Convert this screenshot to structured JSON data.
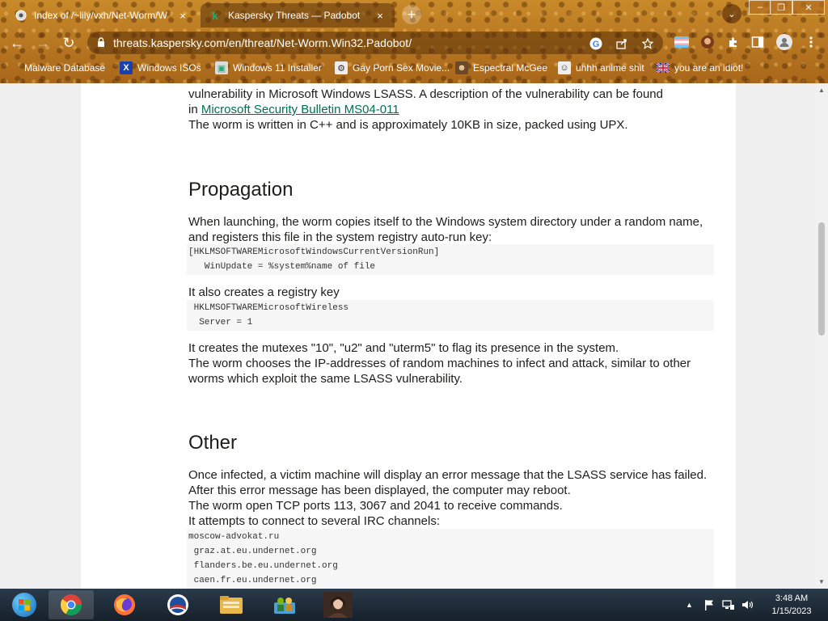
{
  "browser": {
    "tabs": [
      {
        "title": "Index of /~lily/vxh/Net-Worm/W",
        "favicon": "website-icon",
        "close": "×"
      },
      {
        "title": "Kaspersky Threats — Padobot",
        "favicon": "kaspersky-k-icon",
        "favicon_glyph": "k",
        "close": "×"
      }
    ],
    "new_tab": "+",
    "tab_search": "⌄",
    "window_controls": {
      "minimize": "–",
      "maximize": "❐",
      "close": "✕"
    },
    "nav": {
      "back": "←",
      "forward": "→",
      "reload": "↻"
    },
    "url": "threats.kaspersky.com/en/threat/Net-Worm.Win32.Padobot/",
    "lock_glyph": "🔒",
    "bookmarks": [
      {
        "label": "Malware Database",
        "icon": "lock-icon"
      },
      {
        "label": "Windows ISOs",
        "icon": "x-icon"
      },
      {
        "label": "Windows 11 Installer",
        "icon": "installer-icon"
      },
      {
        "label": "Gay Porn Sex Movie...",
        "icon": "site-icon"
      },
      {
        "label": "Espectral McGee",
        "icon": "character-icon"
      },
      {
        "label": "uhhh anime shit",
        "icon": "anime-icon"
      },
      {
        "label": "you are an idiot!",
        "icon": "flag-icon"
      }
    ]
  },
  "article": {
    "intro_partial": "vulnerability in Microsoft Windows LSASS. A description of the vulnerability can be found",
    "intro_in": "in",
    "intro_link": "Microsoft Security Bulletin MS04-011",
    "intro_size": "The worm is written in C++ and is approximately 10KB in size, packed using UPX.",
    "propagation": {
      "heading": "Propagation",
      "p1": "When launching, the worm copies itself to the Windows system directory under a random name, and registers this file in the system registry auto-run key:",
      "code1": "[HKLMSOFTWAREMicrosoftWindowsCurrentVersionRun]\n   WinUpdate = %system%name of file",
      "p2": "It also creates a registry key",
      "code2": " HKLMSOFTWAREMicrosoftWireless\n  Server = 1",
      "p3": "It creates the mutexes \"10\", \"u2\" and \"uterm5\" to flag its presence in the system.",
      "p4": "The worm chooses the IP-addresses of random machines to infect and attack, similar to other worms which exploit the same LSASS vulnerability."
    },
    "other": {
      "heading": "Other",
      "p1": "Once infected, a victim machine will display an error message that the LSASS service has failed. After this error message has been displayed, the computer may reboot.",
      "p2": "The worm open TCP ports 113, 3067 and 2041 to receive commands.",
      "p3": "It attempts to connect to several IRC channels:",
      "code3": "moscow-advokat.ru\n graz.at.eu.undernet.org\n flanders.be.eu.undernet.org\n caen.fr.eu.undernet.org"
    }
  },
  "taskbar": {
    "time": "3:48 AM",
    "date": "1/15/2023",
    "apps": [
      "start-orb-icon",
      "chrome-icon",
      "firefox-icon",
      "obama-logo-icon",
      "explorer-folder-icon",
      "network-people-icon",
      "portrait-icon"
    ],
    "tray_up": "▲"
  },
  "colors": {
    "link": "#00714d",
    "chrome_theme": "#b8741c"
  }
}
